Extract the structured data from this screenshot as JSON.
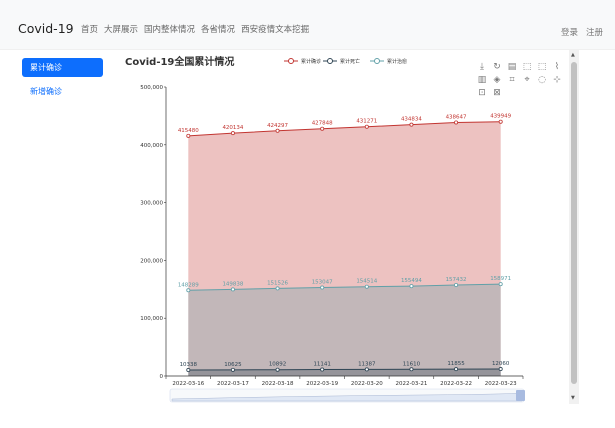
{
  "navbar": {
    "brand": "Covid-19",
    "links": [
      "首页",
      "大屏展示",
      "国内整体情况",
      "各省情况",
      "西安疫情文本挖掘"
    ],
    "login": "登录",
    "register": "注册"
  },
  "sidebar": {
    "items": [
      {
        "label": "累计确诊",
        "active": true
      },
      {
        "label": "新增确诊",
        "active": false
      }
    ]
  },
  "toolbox_icons": [
    "download-icon",
    "refresh-icon",
    "data-view-icon",
    "zoom-icon",
    "zoom-back-icon",
    "line-type-icon",
    "bar-type-icon",
    "stack-icon",
    "rect-select-icon",
    "polygon-select-icon",
    "keep-select-icon",
    "clear-select-icon",
    "restore-icon",
    "magic-icon"
  ],
  "colors": {
    "confirmed": "#c23531",
    "deaths": "#2f4554",
    "recovered": "#61a0a8",
    "primary": "#0d6efd"
  },
  "chart_data": {
    "type": "area",
    "title": "Covid-19全国累计情况",
    "categories": [
      "2022-03-16",
      "2022-03-17",
      "2022-03-18",
      "2022-03-19",
      "2022-03-20",
      "2022-03-21",
      "2022-03-22",
      "2022-03-23"
    ],
    "series": [
      {
        "name": "累计确诊",
        "values": [
          415480,
          420134,
          424297,
          427848,
          431271,
          434834,
          438647,
          439949
        ]
      },
      {
        "name": "累计死亡",
        "values": [
          10338,
          10625,
          10892,
          11141,
          11387,
          11610,
          11855,
          12060
        ]
      },
      {
        "name": "累计治愈",
        "values": [
          148289,
          149838,
          151526,
          153047,
          154514,
          155494,
          157432,
          158971
        ]
      }
    ],
    "y_ticks": [
      "0",
      "100,000",
      "200,000",
      "300,000",
      "400,000",
      "500,000"
    ],
    "ylim": [
      0,
      500000
    ],
    "legend_position": "top-center",
    "grid": false,
    "stacked": false
  }
}
